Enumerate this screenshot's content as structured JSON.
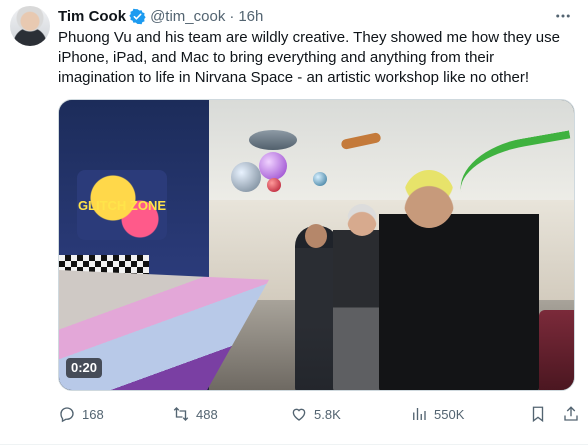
{
  "tweet": {
    "author_name": "Tim Cook",
    "handle": "@tim_cook",
    "separator": "·",
    "time": "16h",
    "text": "Phuong Vu and his team are wildly creative. They showed me how they use iPhone, iPad, and Mac to bring everything and anything from their imagination to life in Nirvana Space - an artistic workshop like no other!",
    "video": {
      "duration": "0:20",
      "sign_text": "GLITCH ZONE"
    },
    "actions": {
      "replies": "168",
      "reposts": "488",
      "likes": "5.8K",
      "views": "550K"
    },
    "icons": {
      "verified": "verified-badge-icon",
      "more": "more-options-icon",
      "reply": "reply-icon",
      "repost": "repost-icon",
      "like": "like-icon",
      "views": "views-icon",
      "bookmark": "bookmark-icon",
      "share": "share-icon"
    },
    "colors": {
      "verified": "#1d9bf0",
      "secondary_text": "#536471",
      "primary_text": "#0f1419"
    }
  }
}
